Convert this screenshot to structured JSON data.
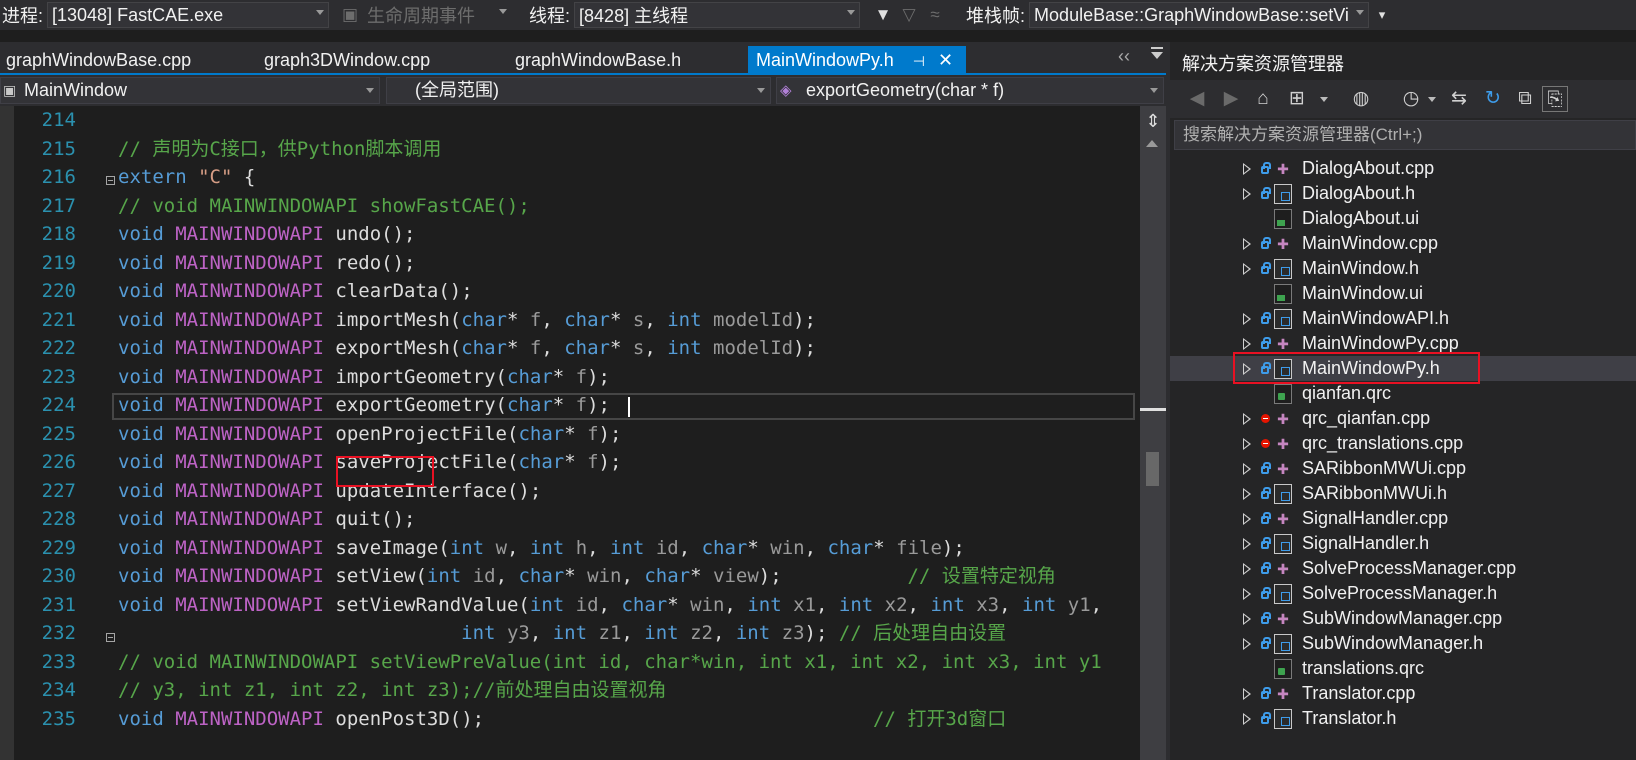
{
  "toolbar": {
    "process_label": "进程:",
    "process_value": "[13048] FastCAE.exe",
    "lifecycle_label": "生命周期事件",
    "thread_label": "线程:",
    "thread_value": "[8428] 主线程",
    "stack_label": "堆栈帧:",
    "stack_value": "ModuleBase::GraphWindowBase::setVi"
  },
  "tabs": [
    {
      "label": "graphWindowBase.cpp",
      "active": false
    },
    {
      "label": "graph3DWindow.cpp",
      "active": false
    },
    {
      "label": "graphWindowBase.h",
      "active": false
    },
    {
      "label": "MainWindowPy.h",
      "active": true
    }
  ],
  "navbar": {
    "class_scope": "MainWindow",
    "global_scope": "(全局范围)",
    "member": "exportGeometry(char * f)"
  },
  "editor": {
    "line_numbers": [
      "214",
      "215",
      "216",
      "217",
      "218",
      "219",
      "220",
      "221",
      "222",
      "223",
      "224",
      "225",
      "226",
      "227",
      "228",
      "229",
      "230",
      "231",
      "232",
      "233",
      "234",
      "235"
    ],
    "lines": [
      "",
      "// 声明为C接口，供Python脚本调用",
      "extern \"C\" {",
      "// void MAINWINDOWAPI showFastCAE();",
      "void MAINWINDOWAPI undo();",
      "void MAINWINDOWAPI redo();",
      "void MAINWINDOWAPI clearData();",
      "void MAINWINDOWAPI importMesh(char* f, char* s, int modelId);",
      "void MAINWINDOWAPI exportMesh(char* f, char* s, int modelId);",
      "void MAINWINDOWAPI importGeometry(char* f);",
      "void MAINWINDOWAPI exportGeometry(char* f);",
      "void MAINWINDOWAPI openProjectFile(char* f);",
      "void MAINWINDOWAPI saveProjectFile(char* f);",
      "void MAINWINDOWAPI updateInterface();",
      "void MAINWINDOWAPI quit();",
      "void MAINWINDOWAPI saveImage(int w, int h, int id, char* win, char* file);",
      "void MAINWINDOWAPI setView(int id, char* win, char* view);           // 设置特定视角",
      "void MAINWINDOWAPI setViewRandValue(int id, char* win, int x1, int x2, int x3, int y1,",
      "                              int y3, int z1, int z2, int z3); // 后处理自由设置",
      "// void MAINWINDOWAPI setViewPreValue(int id, char*win, int x1, int x2, int x3, int y1",
      "// y3, int z1, int z2, int z3);//前处理自由设置视角",
      "void MAINWINDOWAPI openPost3D();                                  // 打开3d窗口"
    ]
  },
  "solution_explorer": {
    "title": "解决方案资源管理器",
    "search_placeholder": "搜索解决方案资源管理器(Ctrl+;)",
    "items": [
      {
        "label": "DialogAbout.cpp",
        "type": "cpp",
        "expandable": true,
        "status": "lock"
      },
      {
        "label": "DialogAbout.h",
        "type": "h",
        "expandable": true,
        "status": "lock"
      },
      {
        "label": "DialogAbout.ui",
        "type": "ui",
        "expandable": false,
        "status": "none"
      },
      {
        "label": "MainWindow.cpp",
        "type": "cpp",
        "expandable": true,
        "status": "lock"
      },
      {
        "label": "MainWindow.h",
        "type": "h",
        "expandable": true,
        "status": "lock"
      },
      {
        "label": "MainWindow.ui",
        "type": "ui",
        "expandable": false,
        "status": "none"
      },
      {
        "label": "MainWindowAPI.h",
        "type": "h",
        "expandable": true,
        "status": "lock"
      },
      {
        "label": "MainWindowPy.cpp",
        "type": "cpp",
        "expandable": true,
        "status": "lock"
      },
      {
        "label": "MainWindowPy.h",
        "type": "h",
        "expandable": true,
        "status": "lock",
        "selected": true
      },
      {
        "label": "qianfan.qrc",
        "type": "qrc",
        "expandable": false,
        "status": "none"
      },
      {
        "label": "qrc_qianfan.cpp",
        "type": "cpp",
        "expandable": true,
        "status": "minus"
      },
      {
        "label": "qrc_translations.cpp",
        "type": "cpp",
        "expandable": true,
        "status": "minus"
      },
      {
        "label": "SARibbonMWUi.cpp",
        "type": "cpp",
        "expandable": true,
        "status": "lock"
      },
      {
        "label": "SARibbonMWUi.h",
        "type": "h",
        "expandable": true,
        "status": "lock"
      },
      {
        "label": "SignalHandler.cpp",
        "type": "cpp",
        "expandable": true,
        "status": "lock"
      },
      {
        "label": "SignalHandler.h",
        "type": "h",
        "expandable": true,
        "status": "lock"
      },
      {
        "label": "SolveProcessManager.cpp",
        "type": "cpp",
        "expandable": true,
        "status": "lock"
      },
      {
        "label": "SolveProcessManager.h",
        "type": "h",
        "expandable": true,
        "status": "lock"
      },
      {
        "label": "SubWindowManager.cpp",
        "type": "cpp",
        "expandable": true,
        "status": "lock"
      },
      {
        "label": "SubWindowManager.h",
        "type": "h",
        "expandable": true,
        "status": "lock"
      },
      {
        "label": "translations.qrc",
        "type": "qrc",
        "expandable": false,
        "status": "none"
      },
      {
        "label": "Translator.cpp",
        "type": "cpp",
        "expandable": true,
        "status": "lock"
      },
      {
        "label": "Translator.h",
        "type": "h",
        "expandable": true,
        "status": "lock"
      }
    ]
  },
  "colors": {
    "keyword": "#569cd6",
    "macro": "#bd63c5",
    "comment": "#57a64a",
    "string": "#d69d85",
    "line_number": "#2b91af",
    "accent": "#007acc",
    "highlight_box": "#e81123"
  }
}
